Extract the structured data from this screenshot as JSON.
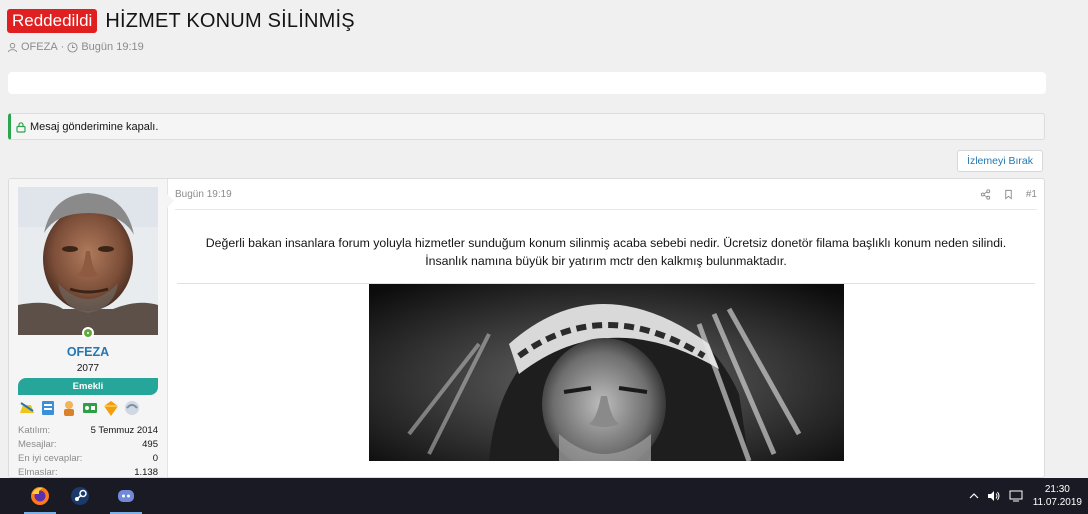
{
  "thread": {
    "status_badge": "Reddedildi",
    "title": "HİZMET KONUM SİLİNMİŞ",
    "author": "OFEZA",
    "separator": " · ",
    "time": "Bugün 19:19"
  },
  "notice": {
    "text": "Mesaj gönderimine kapalı."
  },
  "actions": {
    "unwatch": "İzlemeyi Bırak"
  },
  "post": {
    "time": "Bugün 19:19",
    "number": "#1",
    "body_line1": "Değerli bakan insanlara forum yoluyla hizmetler sunduğum konum silinmiş acaba sebebi nedir. Ücretsiz donetör filama başlıklı konum neden silindi.",
    "body_line2": "İnsanlık namına büyük bir yatırım mctr den kalkmış bulunmaktadır."
  },
  "user": {
    "name": "OFEZA",
    "number": "2077",
    "role": "Emekli",
    "online": true,
    "stats": [
      {
        "label": "Katılım:",
        "value": "5 Temmuz 2014"
      },
      {
        "label": "Mesajlar:",
        "value": "495"
      },
      {
        "label": "En iyi cevaplar:",
        "value": "0"
      },
      {
        "label": "Elmaslar:",
        "value": "1.138"
      }
    ]
  },
  "taskbar": {
    "time": "21:30",
    "date": "11.07.2019",
    "apps": [
      "firefox-icon",
      "steam-icon",
      "discord-icon"
    ]
  },
  "colors": {
    "badge_red": "#e02020",
    "link_blue": "#2577b1",
    "role_teal": "#26a69a",
    "notice_green": "#2da44e"
  }
}
